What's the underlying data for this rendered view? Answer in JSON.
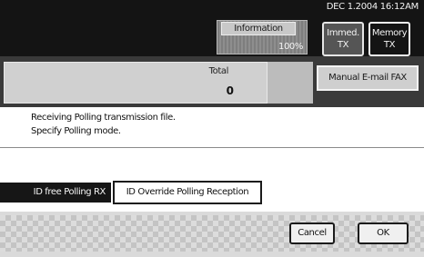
{
  "status": {
    "text": "DEC   1.2004 16:12AM"
  },
  "header": {
    "information_label": "Information",
    "memory_percent": "100%",
    "immediate_tx_label": "Immed.\nTX",
    "memory_tx_label": "Memory\nTX"
  },
  "total": {
    "label": "Total",
    "value": "0"
  },
  "manual_email_fax_label": "Manual E-mail FAX",
  "message": {
    "line1": "Receiving Polling transmission file.",
    "line2": "Specify Polling mode."
  },
  "options": {
    "id_free": "ID free Polling RX",
    "id_override": "ID Override Polling Reception"
  },
  "actions": {
    "cancel_label": "Cancel",
    "ok_label": "OK"
  }
}
